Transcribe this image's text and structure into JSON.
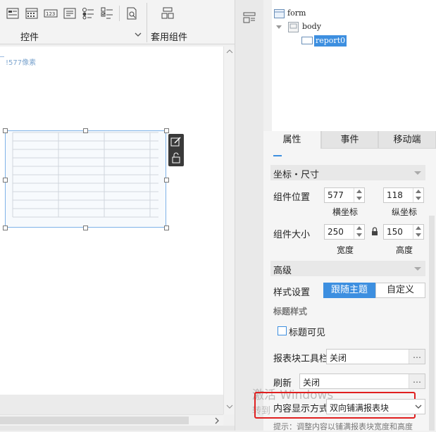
{
  "toolbar": {
    "controls_label": "控件",
    "apply_component_label": "套用组件"
  },
  "canvas": {
    "ruler_text": "!577像素"
  },
  "tree": {
    "root": "form",
    "body": "body",
    "child": "report0"
  },
  "tabs": {
    "properties": "属性",
    "events": "事件",
    "mobile": "移动端"
  },
  "coords": {
    "section_title": "坐标・尺寸",
    "position_label": "组件位置",
    "x_value": "577",
    "y_value": "118",
    "x_caption": "横坐标",
    "y_caption": "纵坐标",
    "size_label": "组件大小",
    "width_value": "250",
    "height_value": "150",
    "width_caption": "宽度",
    "height_caption": "高度"
  },
  "advanced": {
    "section_title": "高级",
    "style_label": "样式设置",
    "follow_theme": "跟随主题",
    "custom": "自定义",
    "title_style_label": "标题样式",
    "title_visible": "标题可见",
    "toolbar_label": "报表块工具栏",
    "toolbar_value": "关闭",
    "refresh_label": "刷新",
    "refresh_value": "关闭",
    "display_label": "内容显示方式",
    "display_value": "双向铺满报表块",
    "hint": "提示：调整内容以铺满报表块宽度和高度"
  },
  "watermark": {
    "line1": "激活 Windows",
    "line2": "转到"
  },
  "colors": {
    "accent": "#3d8fe0",
    "highlight_border": "#e02020"
  }
}
